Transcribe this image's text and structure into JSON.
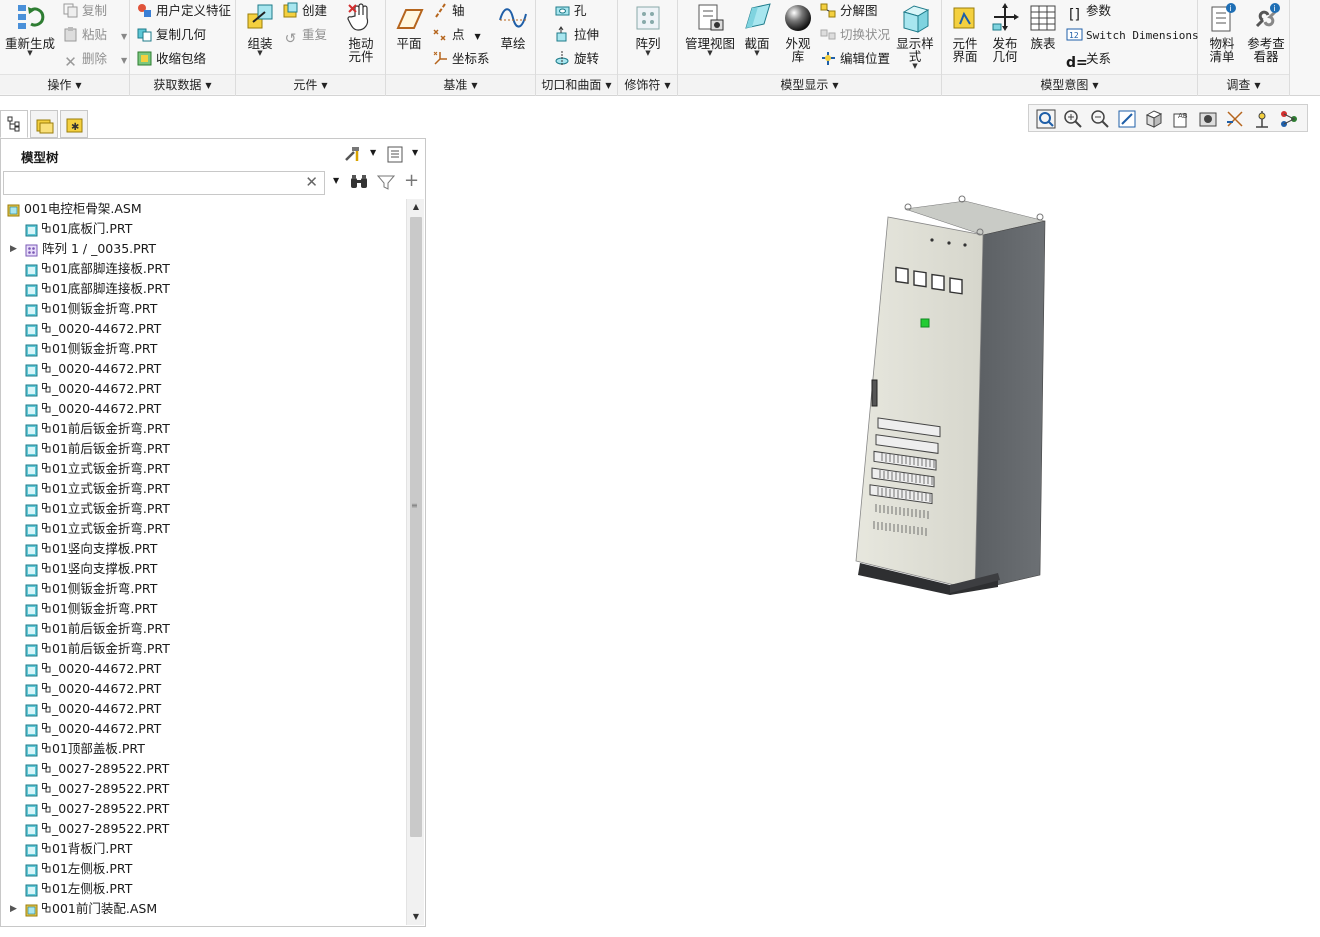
{
  "ribbon": {
    "groups": [
      {
        "label": "操作"
      },
      {
        "label": "获取数据"
      },
      {
        "label": "元件"
      },
      {
        "label": "基准"
      },
      {
        "label": "切口和曲面"
      },
      {
        "label": "修饰符"
      },
      {
        "label": "模型显示"
      },
      {
        "label": "模型意图"
      },
      {
        "label": "调查"
      }
    ],
    "ops": {
      "regenerate": "重新生成",
      "copy": "复制",
      "paste": "粘贴",
      "delete": "删除"
    },
    "getdata": {
      "udf": "用户定义特征",
      "copy_geom": "复制几何",
      "shrinkwrap": "收缩包络"
    },
    "component": {
      "assemble": "组装",
      "create": "创建",
      "repeat": "重复",
      "drag": "拖动\n元件"
    },
    "datum": {
      "plane": "平面",
      "axis": "轴",
      "point": "点",
      "csys": "坐标系",
      "sketch": "草绘"
    },
    "cuts": {
      "hole": "孔",
      "extrude": "拉伸",
      "revolve": "旋转"
    },
    "modifiers": {
      "pattern": "阵列"
    },
    "display": {
      "manage_views": "管理视图",
      "section": "截面",
      "appearance": "外观\n库",
      "explode": "分解图",
      "toggle": "切换状况",
      "edit_pos": "编辑位置",
      "display_style": "显示样\n式"
    },
    "intent": {
      "comp_interface": "元件\n界面",
      "publish_geom": "发布\n几何",
      "family_table": "族表",
      "params": "参数",
      "switch_dims": "Switch Dimensions",
      "relations": "关系"
    },
    "investigate": {
      "bom": "物料\n清单",
      "ref_viewer": "参考查\n看器"
    }
  },
  "tree": {
    "title": "模型树",
    "search_placeholder": "",
    "root": "001电控柜骨架.ASM",
    "items": [
      {
        "label": "01底板门.PRT",
        "type": "part"
      },
      {
        "label": "阵列 1 / _0035.PRT",
        "type": "pattern"
      },
      {
        "label": "01底部脚连接板.PRT",
        "type": "part"
      },
      {
        "label": "01底部脚连接板.PRT",
        "type": "part"
      },
      {
        "label": "01侧钣金折弯.PRT",
        "type": "part"
      },
      {
        "label": "_0020-44672.PRT",
        "type": "part"
      },
      {
        "label": "01侧钣金折弯.PRT",
        "type": "part"
      },
      {
        "label": "_0020-44672.PRT",
        "type": "part"
      },
      {
        "label": "_0020-44672.PRT",
        "type": "part"
      },
      {
        "label": "_0020-44672.PRT",
        "type": "part"
      },
      {
        "label": "01前后钣金折弯.PRT",
        "type": "part"
      },
      {
        "label": "01前后钣金折弯.PRT",
        "type": "part"
      },
      {
        "label": "01立式钣金折弯.PRT",
        "type": "part"
      },
      {
        "label": "01立式钣金折弯.PRT",
        "type": "part"
      },
      {
        "label": "01立式钣金折弯.PRT",
        "type": "part"
      },
      {
        "label": "01立式钣金折弯.PRT",
        "type": "part"
      },
      {
        "label": "01竖向支撑板.PRT",
        "type": "part"
      },
      {
        "label": "01竖向支撑板.PRT",
        "type": "part"
      },
      {
        "label": "01侧钣金折弯.PRT",
        "type": "part"
      },
      {
        "label": "01侧钣金折弯.PRT",
        "type": "part"
      },
      {
        "label": "01前后钣金折弯.PRT",
        "type": "part"
      },
      {
        "label": "01前后钣金折弯.PRT",
        "type": "part"
      },
      {
        "label": "_0020-44672.PRT",
        "type": "part"
      },
      {
        "label": "_0020-44672.PRT",
        "type": "part"
      },
      {
        "label": "_0020-44672.PRT",
        "type": "part"
      },
      {
        "label": "_0020-44672.PRT",
        "type": "part"
      },
      {
        "label": "01顶部盖板.PRT",
        "type": "part"
      },
      {
        "label": "_0027-289522.PRT",
        "type": "part"
      },
      {
        "label": "_0027-289522.PRT",
        "type": "part"
      },
      {
        "label": "_0027-289522.PRT",
        "type": "part"
      },
      {
        "label": "_0027-289522.PRT",
        "type": "part"
      },
      {
        "label": "01背板门.PRT",
        "type": "part"
      },
      {
        "label": "01左侧板.PRT",
        "type": "part"
      },
      {
        "label": "01左侧板.PRT",
        "type": "part"
      },
      {
        "label": "001前门装配.ASM",
        "type": "assembly"
      }
    ]
  },
  "colors": {
    "accent": "#1f6fb5",
    "part_icon": "#5ec7d6",
    "asm_icon": "#e6c64a",
    "status_green": "#22cc33"
  }
}
